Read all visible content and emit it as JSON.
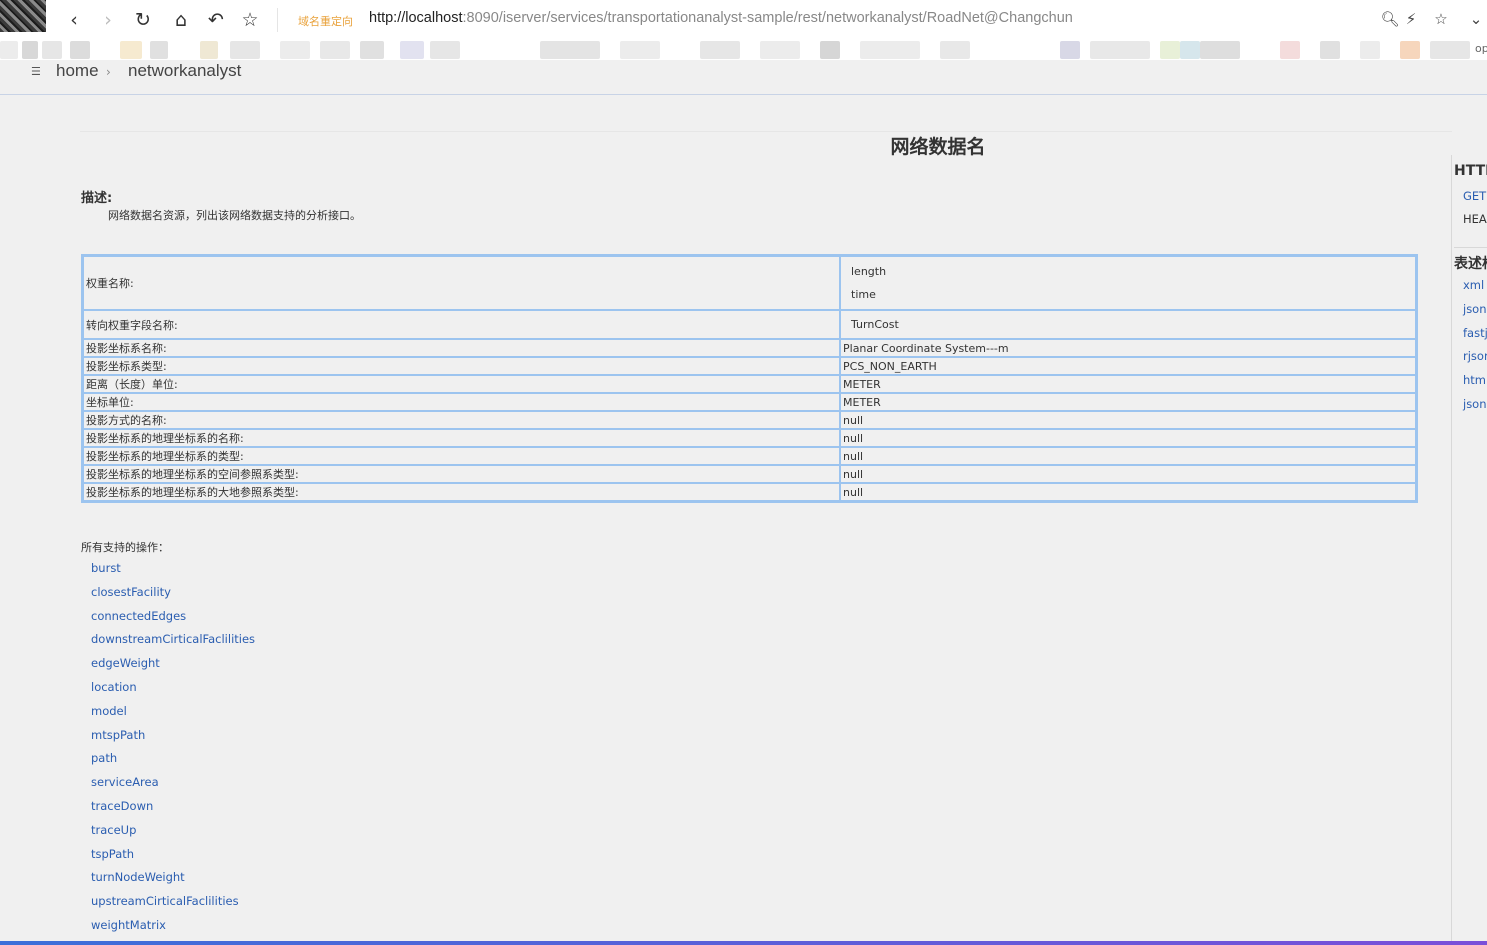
{
  "browser": {
    "redirect_badge": "域名重定向",
    "url_host": "http://localhost",
    "url_rest": ":8090/iserver/services/transportationanalyst-sample/rest/networkanalyst/RoadNet@Changchun",
    "bookmark_overflow": "op"
  },
  "breadcrumb": {
    "home": "home",
    "separator": "›",
    "current": "networkanalyst"
  },
  "page": {
    "title": "网络数据名",
    "description_heading": "描述:",
    "description_text": "网络数据名资源，列出该网络数据支持的分析接口。"
  },
  "properties": {
    "weight_label": "权重名称:",
    "weight_values": [
      "length",
      "time"
    ],
    "turn_label": "转向权重字段名称:",
    "turn_value": "TurnCost",
    "rows": [
      {
        "key": "投影坐标系名称:",
        "value": "Planar Coordinate System---m"
      },
      {
        "key": "投影坐标系类型:",
        "value": "PCS_NON_EARTH"
      },
      {
        "key": "距离（长度）单位:",
        "value": "METER"
      },
      {
        "key": "坐标单位:",
        "value": "METER"
      },
      {
        "key": "投影方式的名称:",
        "value": "null"
      },
      {
        "key": "投影坐标系的地理坐标系的名称:",
        "value": "null"
      },
      {
        "key": "投影坐标系的地理坐标系的类型:",
        "value": "null"
      },
      {
        "key": "投影坐标系的地理坐标系的空间参照系类型:",
        "value": "null"
      },
      {
        "key": "投影坐标系的地理坐标系的大地参照系类型:",
        "value": "null"
      }
    ]
  },
  "operations": {
    "heading": "所有支持的操作：",
    "items": [
      "burst",
      "closestFacility",
      "connectedEdges",
      "downstreamCirticalFaclilities",
      "edgeWeight",
      "location",
      "model",
      "mtspPath",
      "path",
      "serviceArea",
      "traceDown",
      "traceUp",
      "tspPath",
      "turnNodeWeight",
      "upstreamCirticalFaclilities",
      "weightMatrix"
    ]
  },
  "sidebar": {
    "http_heading": "HTTP",
    "methods": [
      "GET",
      "HEAD"
    ],
    "formats_heading": "表述格",
    "formats": [
      "xml",
      "json",
      "fastjson",
      "rjson",
      "html",
      "jsonp"
    ]
  }
}
